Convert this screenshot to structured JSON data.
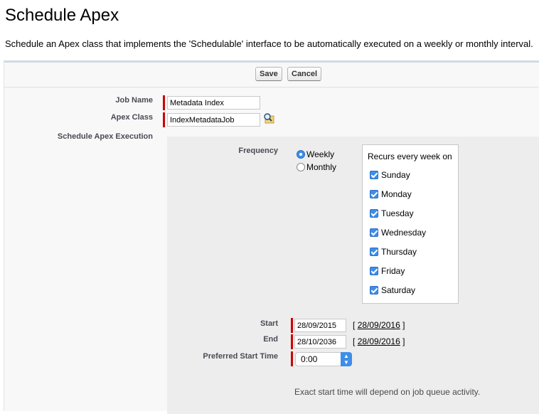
{
  "page": {
    "title": "Schedule Apex",
    "description": "Schedule an Apex class that implements the 'Schedulable' interface to be automatically executed on a weekly or monthly interval."
  },
  "toolbar": {
    "save_label": "Save",
    "cancel_label": "Cancel"
  },
  "form": {
    "job_name_label": "Job Name",
    "job_name_value": "Metadata Index",
    "apex_class_label": "Apex Class",
    "apex_class_value": "IndexMetadataJob",
    "schedule_label": "Schedule Apex Execution",
    "frequency_label": "Frequency",
    "frequency_options": [
      {
        "label": "Weekly",
        "selected": true
      },
      {
        "label": "Monthly",
        "selected": false
      }
    ],
    "recurs_title": "Recurs every week on",
    "days": [
      {
        "label": "Sunday",
        "checked": true
      },
      {
        "label": "Monday",
        "checked": true
      },
      {
        "label": "Tuesday",
        "checked": true
      },
      {
        "label": "Wednesday",
        "checked": true
      },
      {
        "label": "Thursday",
        "checked": true
      },
      {
        "label": "Friday",
        "checked": true
      },
      {
        "label": "Saturday",
        "checked": true
      }
    ],
    "start_label": "Start",
    "start_value": "28/09/2015",
    "start_today": "28/09/2016",
    "end_label": "End",
    "end_value": "28/10/2036",
    "end_today": "28/09/2016",
    "bracket_open": "[",
    "bracket_close": "]",
    "preferred_label": "Preferred Start Time",
    "preferred_value": "0:00",
    "note": "Exact start time will depend on job queue activity."
  },
  "icons": {
    "lookup": "lookup-magnifier-icon",
    "select_arrows": "select-arrows-icon"
  },
  "colors": {
    "required": "#cc0000",
    "accent": "#3d8ee8"
  }
}
